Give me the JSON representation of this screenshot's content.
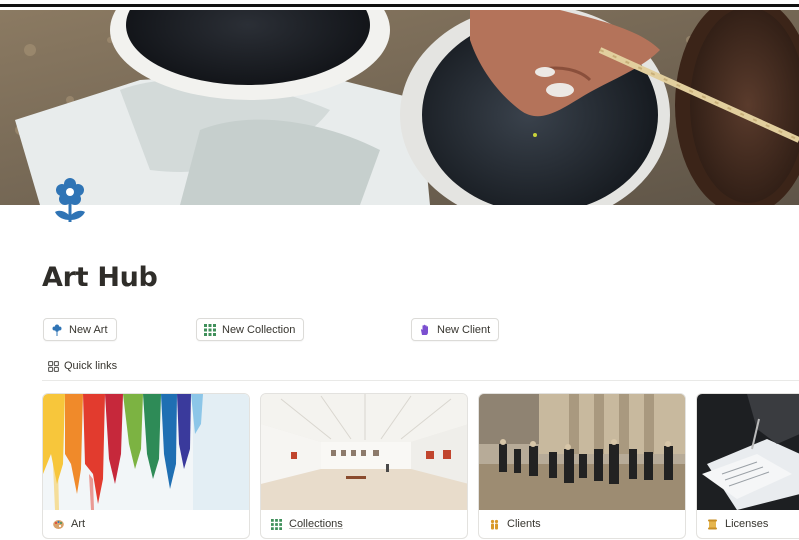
{
  "page": {
    "title": "Art Hub",
    "icon": "flower-icon",
    "cover": "paint-buckets-cover-image"
  },
  "buttons": [
    {
      "label": "New Art",
      "icon": "flower-icon"
    },
    {
      "label": "New Collection",
      "icon": "grid-icon"
    },
    {
      "label": "New Client",
      "icon": "hand-icon"
    }
  ],
  "quick_links": {
    "label": "Quick links",
    "icon": "gallery-grid-icon"
  },
  "cards": [
    {
      "label": "Art",
      "icon": "palette-icon",
      "image": "colorful-paint-drips"
    },
    {
      "label": "Collections",
      "icon": "grid-icon",
      "image": "gallery-hall"
    },
    {
      "label": "Clients",
      "icon": "people-icon",
      "image": "street-crowd-painting"
    },
    {
      "label": "Licenses",
      "icon": "scroll-icon",
      "image": "signing-documents"
    }
  ],
  "colors": {
    "accent_blue": "#2f74b5",
    "grid_green": "#3f8f5a",
    "hand_purple": "#7b4fd0"
  }
}
